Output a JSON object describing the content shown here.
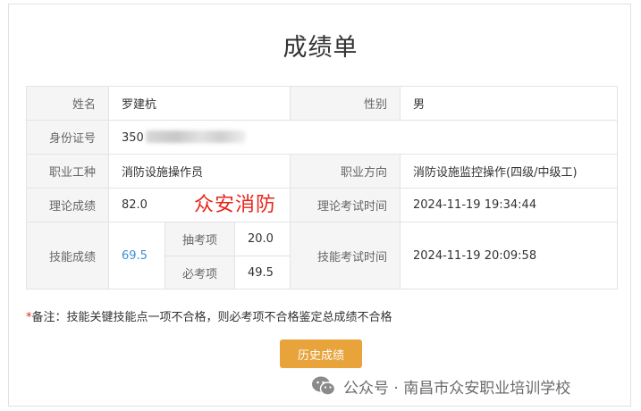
{
  "page": {
    "title": "成绩单"
  },
  "table": {
    "name_label": "姓名",
    "name_value": "罗建杭",
    "gender_label": "性别",
    "gender_value": "男",
    "id_label": "身份证号",
    "id_value_visible": "350",
    "job_label": "职业工种",
    "job_value": "消防设施操作员",
    "direction_label": "职业方向",
    "direction_value": "消防设施监控操作(四级/中级工)",
    "theory_label": "理论成绩",
    "theory_value": "82.0",
    "theory_time_label": "理论考试时间",
    "theory_time_value": "2024-11-19 19:34:44",
    "skill_label": "技能成绩",
    "skill_value": "69.5",
    "sample_label": "抽考项",
    "sample_value": "20.0",
    "required_label": "必考项",
    "required_value": "49.5",
    "skill_time_label": "技能考试时间",
    "skill_time_value": "2024-11-19 20:09:58"
  },
  "watermark": "众安消防",
  "note": {
    "star": "*",
    "text": "备注：技能关键技能点一项不合格，则必考项不合格鉴定总成绩不合格"
  },
  "history_button": "历史成绩",
  "footer": {
    "icon": "wechat-icon",
    "text": "公众号 · 南昌市众安职业培训学校"
  },
  "colors": {
    "accent_button": "#e8a33b",
    "skill_score": "#3b8fd6",
    "watermark": "#e8241b",
    "label_bg": "#f5f5f5"
  }
}
